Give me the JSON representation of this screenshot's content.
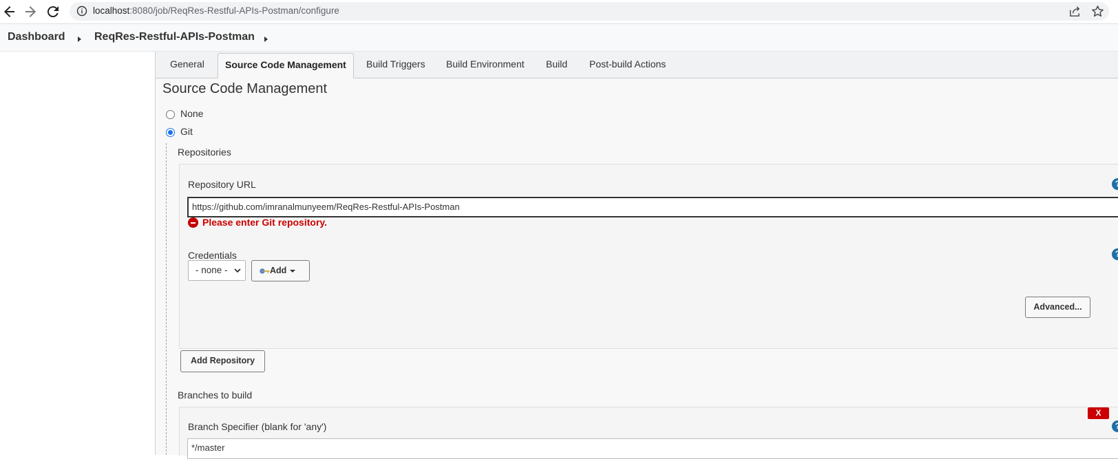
{
  "browser": {
    "url_host": "localhost",
    "url_path": ":8080/job/ReqRes-Restful-APIs-Postman/configure"
  },
  "breadcrumb": {
    "items": [
      "Dashboard",
      "ReqRes-Restful-APIs-Postman"
    ]
  },
  "tabs": [
    {
      "label": "General"
    },
    {
      "label": "Source Code Management"
    },
    {
      "label": "Build Triggers"
    },
    {
      "label": "Build Environment"
    },
    {
      "label": "Build"
    },
    {
      "label": "Post-build Actions"
    }
  ],
  "active_tab": "Source Code Management",
  "scm": {
    "title": "Source Code Management",
    "options": [
      {
        "label": "None",
        "selected": false
      },
      {
        "label": "Git",
        "selected": true
      }
    ],
    "repositories_label": "Repositories",
    "repo_url_label": "Repository URL",
    "repo_url_value": "https://github.com/imranalmunyeem/ReqRes-Restful-APIs-Postman",
    "error_message": "Please enter Git repository.",
    "credentials_label": "Credentials",
    "credentials_selected": "- none -",
    "add_button": "Add",
    "advanced_button": "Advanced...",
    "add_repository_button": "Add Repository",
    "branches_label": "Branches to build",
    "branch_specifier_label": "Branch Specifier (blank for 'any')",
    "branch_specifier_value": "*/master",
    "delete_label": "X",
    "help_glyph": "?"
  },
  "colors": {
    "error": "#cc0000",
    "help": "#1f6ea6",
    "radio_checked": "#1a73e8"
  },
  "icons": [
    "back-arrow-icon",
    "forward-arrow-icon",
    "reload-icon",
    "info-icon",
    "share-icon",
    "star-icon",
    "key-icon",
    "error-icon",
    "help-icon"
  ]
}
